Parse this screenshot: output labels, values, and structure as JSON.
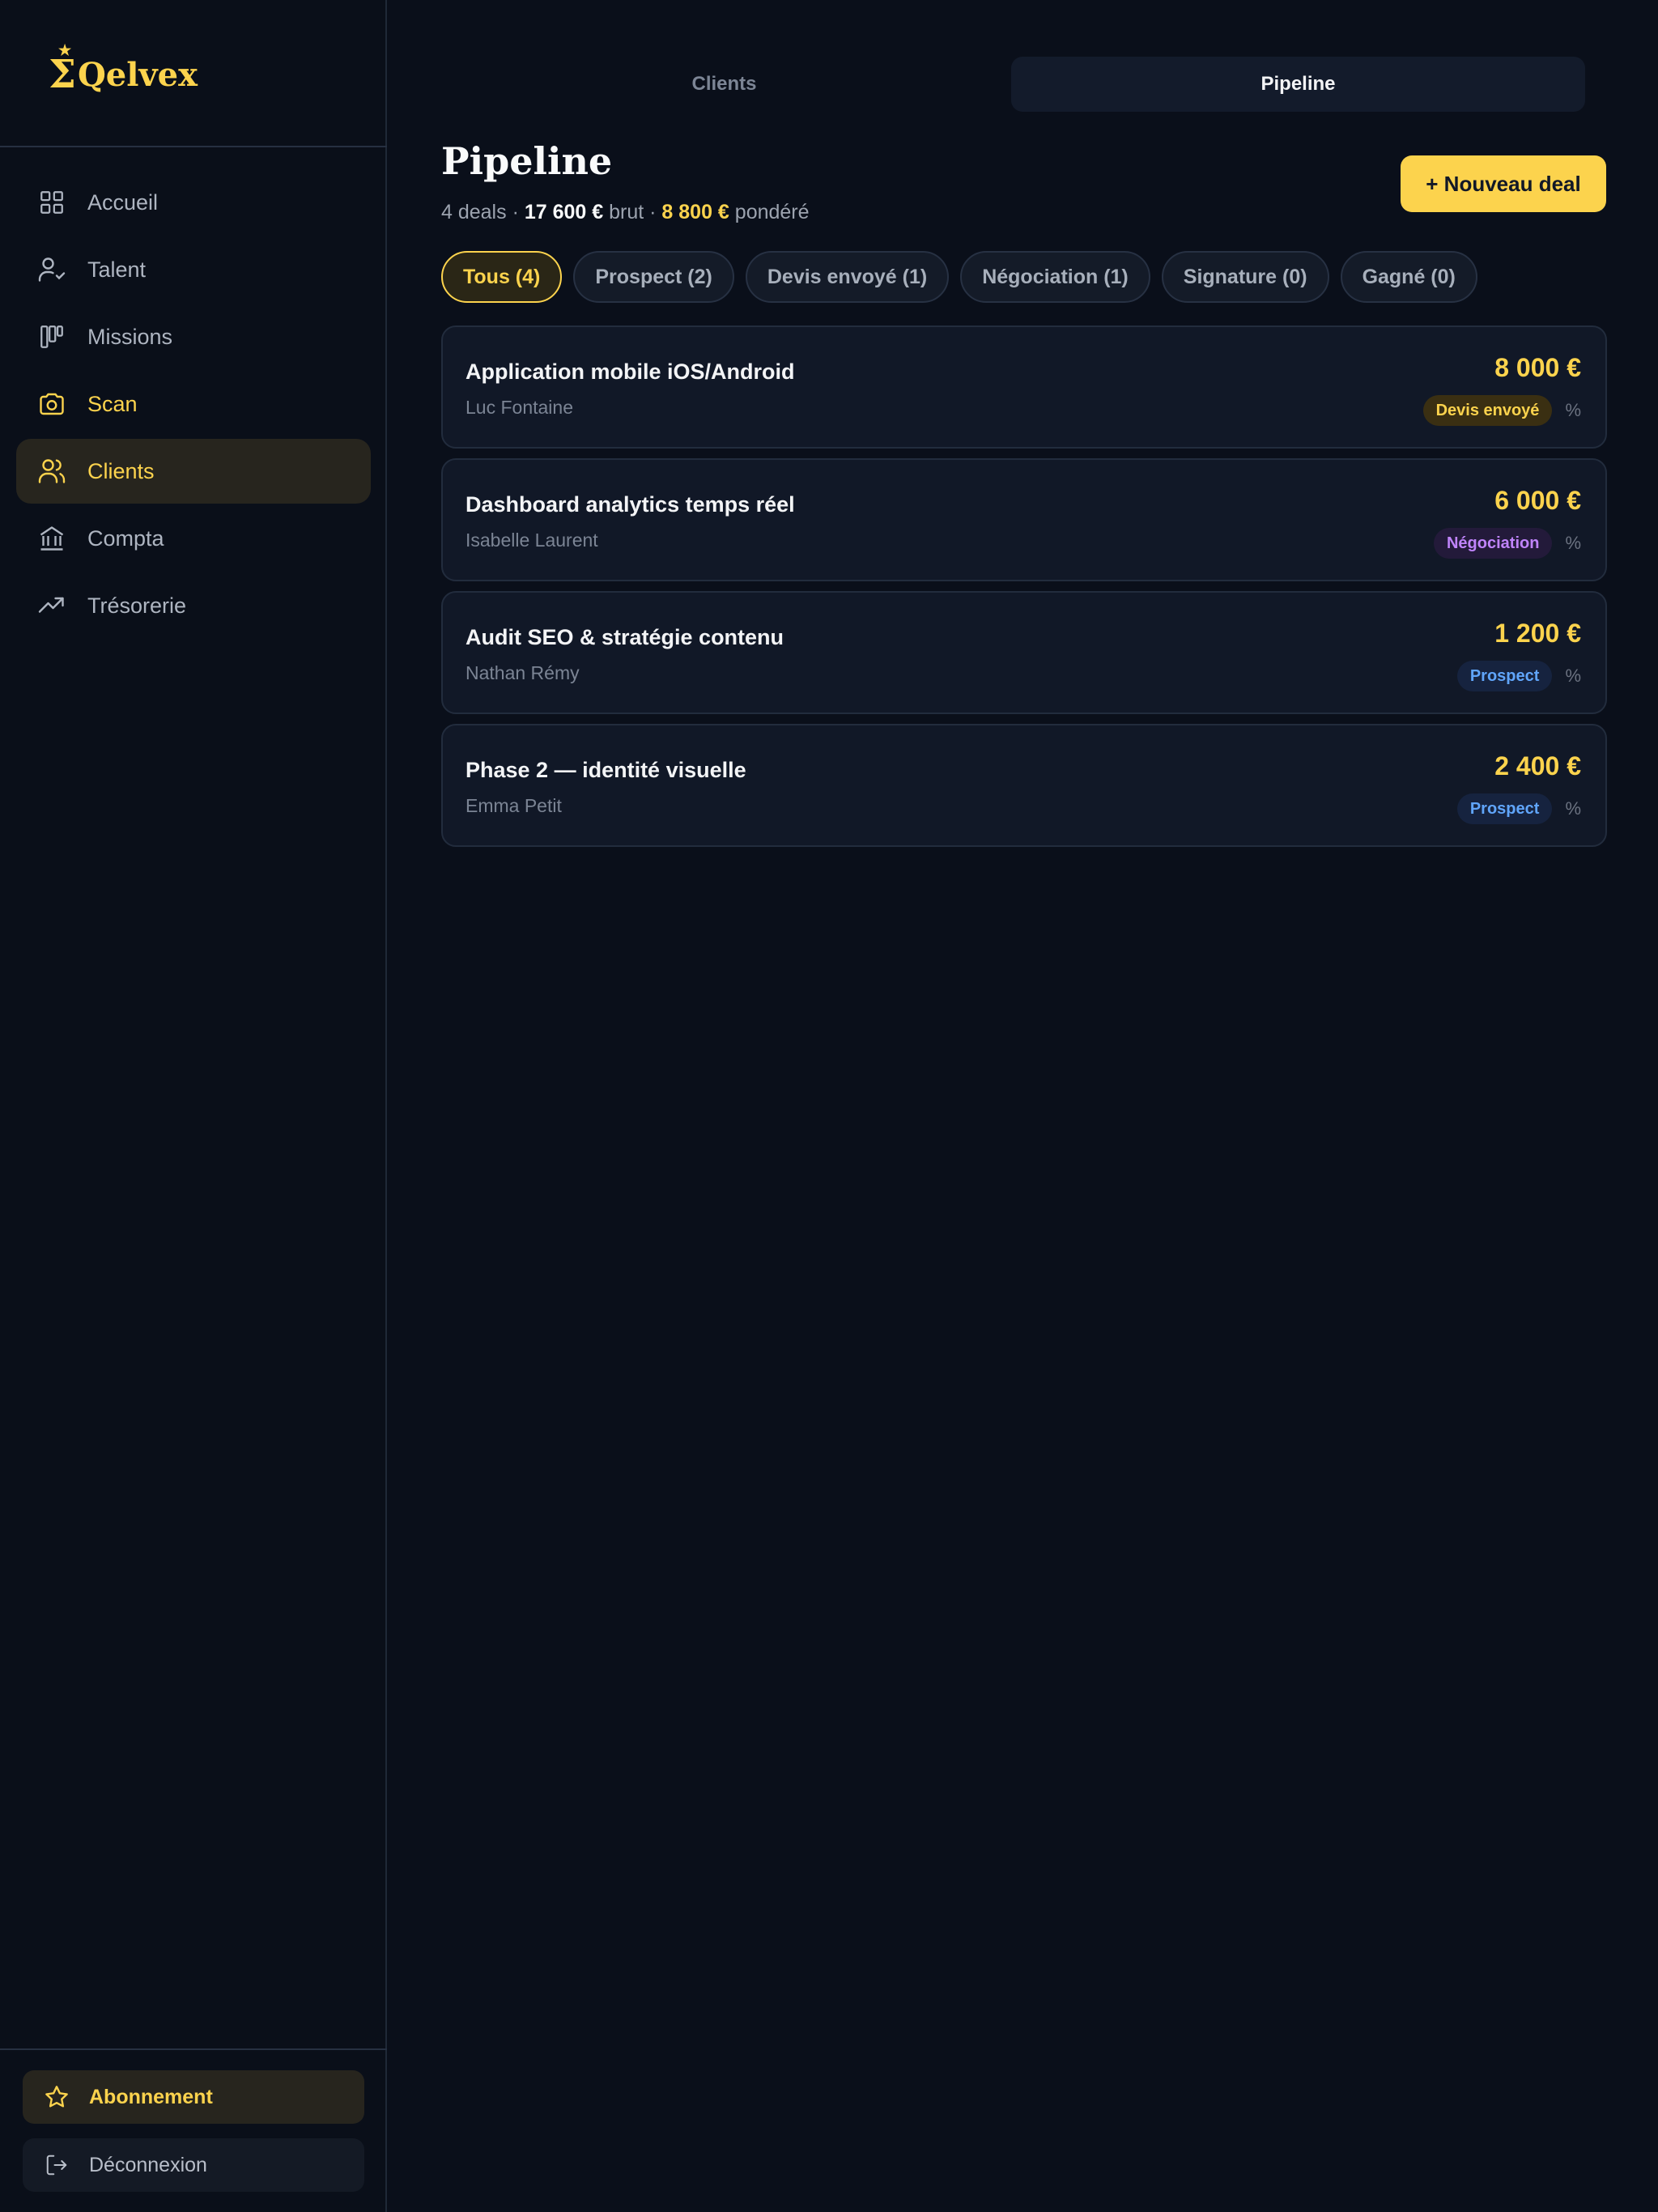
{
  "app": {
    "logo_text": "Qelvex",
    "logo_symbol": "Σ",
    "logo_star": "★"
  },
  "sidebar": {
    "items": [
      {
        "label": "Accueil",
        "icon": "grid-icon"
      },
      {
        "label": "Talent",
        "icon": "user-check-icon"
      },
      {
        "label": "Missions",
        "icon": "kanban-icon"
      },
      {
        "label": "Scan",
        "icon": "camera-icon"
      },
      {
        "label": "Clients",
        "icon": "users-icon"
      },
      {
        "label": "Compta",
        "icon": "bank-icon"
      },
      {
        "label": "Trésorerie",
        "icon": "trending-up-icon"
      }
    ],
    "active": "Clients",
    "abonnement_label": "Abonnement",
    "deconnexion_label": "Déconnexion"
  },
  "tabs": [
    {
      "label": "Clients",
      "active": false
    },
    {
      "label": "Pipeline",
      "active": true
    }
  ],
  "header": {
    "title": "Pipeline",
    "summary_count": "4 deals",
    "summary_sep1": " · ",
    "summary_gross": "17 600 €",
    "summary_gross_label": " brut",
    "summary_sep2": " · ",
    "summary_weighted": "8 800 €",
    "summary_weighted_label": " pondéré",
    "new_deal_label": "+ Nouveau deal"
  },
  "filters": [
    {
      "label": "Tous (4)",
      "active": true
    },
    {
      "label": "Prospect (2)",
      "active": false
    },
    {
      "label": "Devis envoyé (1)",
      "active": false
    },
    {
      "label": "Négociation (1)",
      "active": false
    },
    {
      "label": "Signature (0)",
      "active": false
    },
    {
      "label": "Gagné (0)",
      "active": false
    }
  ],
  "deals": [
    {
      "title": "Application mobile iOS/Android",
      "client": "Luc Fontaine",
      "amount": "8 000 €",
      "stage": "Devis envoyé",
      "pct": "%"
    },
    {
      "title": "Dashboard analytics temps réel",
      "client": "Isabelle Laurent",
      "amount": "6 000 €",
      "stage": "Négociation",
      "pct": "%"
    },
    {
      "title": "Audit SEO & stratégie contenu",
      "client": "Nathan Rémy",
      "amount": "1 200 €",
      "stage": "Prospect",
      "pct": "%"
    },
    {
      "title": "Phase 2 — identité visuelle",
      "client": "Emma Petit",
      "amount": "2 400 €",
      "stage": "Prospect",
      "pct": "%"
    }
  ],
  "colors": {
    "accent": "#fcd34d",
    "background": "#0a0f1a",
    "card": "#111827",
    "negotiation": "#c084fc",
    "prospect": "#60a5fa"
  }
}
